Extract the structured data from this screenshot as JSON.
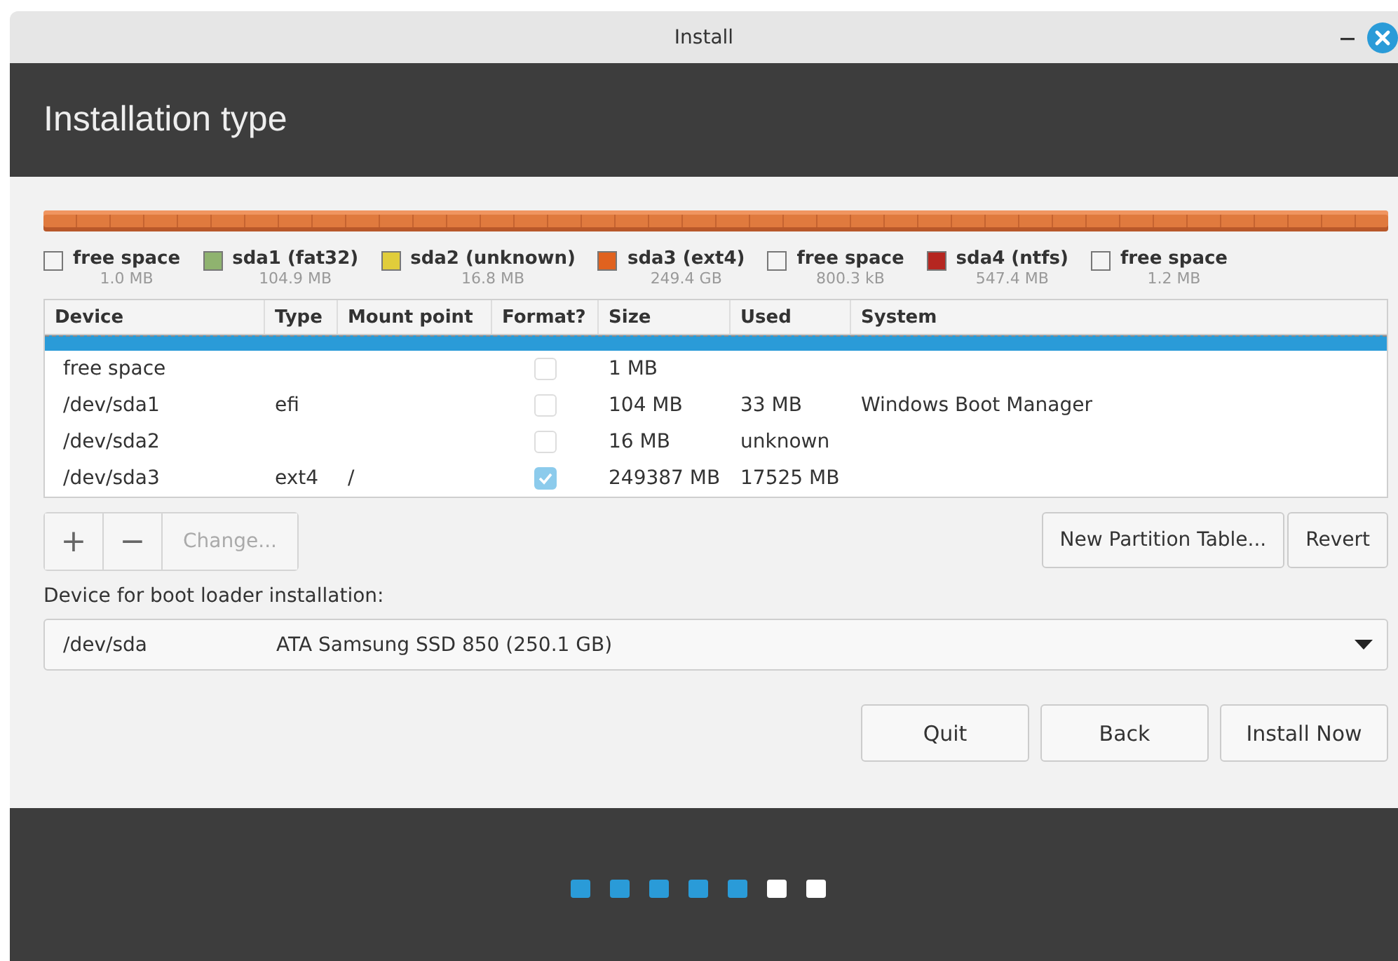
{
  "window": {
    "title": "Install"
  },
  "header": {
    "title": "Installation type"
  },
  "legend": [
    {
      "name": "free space",
      "size": "1.0 MB",
      "color": "#f4f4f4"
    },
    {
      "name": "sda1 (fat32)",
      "size": "104.9 MB",
      "color": "#8fb36f"
    },
    {
      "name": "sda2 (unknown)",
      "size": "16.8 MB",
      "color": "#e1cd3b"
    },
    {
      "name": "sda3 (ext4)",
      "size": "249.4 GB",
      "color": "#e0621f"
    },
    {
      "name": "free space",
      "size": "800.3 kB",
      "color": "#f4f4f4"
    },
    {
      "name": "sda4 (ntfs)",
      "size": "547.4 MB",
      "color": "#b52620"
    },
    {
      "name": "free space",
      "size": "1.2 MB",
      "color": "#f4f4f4"
    }
  ],
  "table": {
    "columns": [
      "Device",
      "Type",
      "Mount point",
      "Format?",
      "Size",
      "Used",
      "System"
    ],
    "rows": [
      {
        "selected": true
      },
      {
        "selected": false,
        "device": "free space",
        "format": false,
        "size": "1 MB"
      },
      {
        "selected": false,
        "device": "/dev/sda1",
        "type": "efi",
        "format": false,
        "size": "104 MB",
        "used": "33 MB",
        "system": "Windows Boot Manager"
      },
      {
        "selected": false,
        "device": "/dev/sda2",
        "format": false,
        "size": "16 MB",
        "used": "unknown"
      },
      {
        "selected": false,
        "device": "/dev/sda3",
        "type": "ext4",
        "mount": "/",
        "format": true,
        "size": "249387 MB",
        "used": "17525 MB"
      }
    ]
  },
  "toolbar": {
    "add": "+",
    "remove": "−",
    "change": "Change...",
    "new_table": "New Partition Table...",
    "revert": "Revert"
  },
  "boot_loader": {
    "label": "Device for boot loader installation:",
    "device": "/dev/sda",
    "description": "ATA Samsung SSD 850 (250.1 GB)"
  },
  "buttons": [
    "Quit",
    "Back",
    "Install Now"
  ],
  "progress": [
    {
      "done": true
    },
    {
      "done": true
    },
    {
      "done": true
    },
    {
      "done": true
    },
    {
      "done": true
    },
    {
      "done": false
    },
    {
      "done": false
    }
  ]
}
